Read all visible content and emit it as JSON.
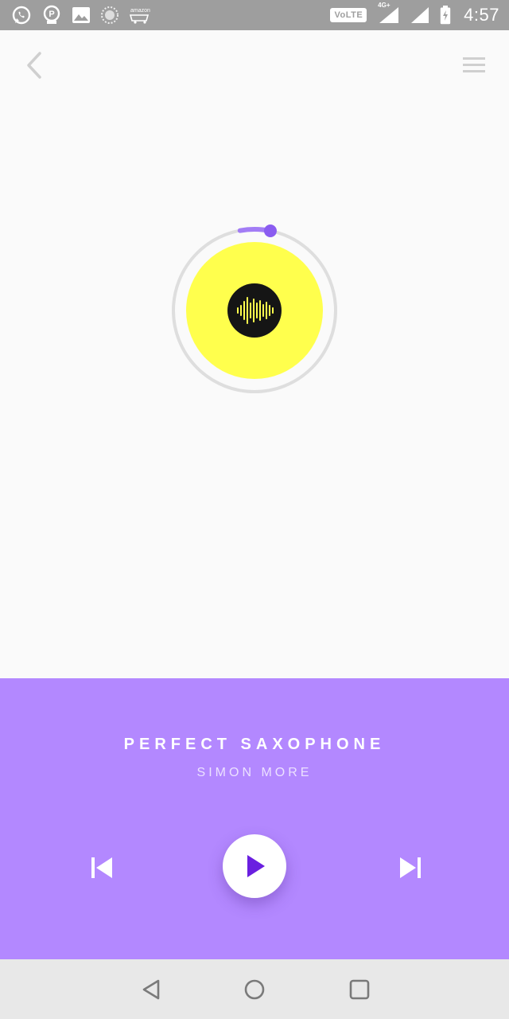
{
  "status_bar": {
    "icons": [
      "whatsapp-icon",
      "paytm-icon",
      "gallery-icon",
      "sync-icon",
      "amazon-icon"
    ],
    "volte": "VoLTE",
    "network": "4G+",
    "time": "4:57"
  },
  "nav": {
    "back_icon": "chevron-left-icon",
    "menu_icon": "hamburger-menu-icon"
  },
  "player": {
    "title": "PERFECT SAXOPHONE",
    "artist": "SIMON MORE",
    "progress": 0.06,
    "colors": {
      "panel": "#b388ff",
      "disc": "#ffff4d",
      "accent": "#8a5cf0",
      "play_icon": "#6a1fe0"
    },
    "controls": [
      "skip-previous-icon",
      "play-icon",
      "skip-next-icon"
    ]
  },
  "system_nav": [
    "back-triangle-icon",
    "home-circle-icon",
    "recents-square-icon"
  ]
}
